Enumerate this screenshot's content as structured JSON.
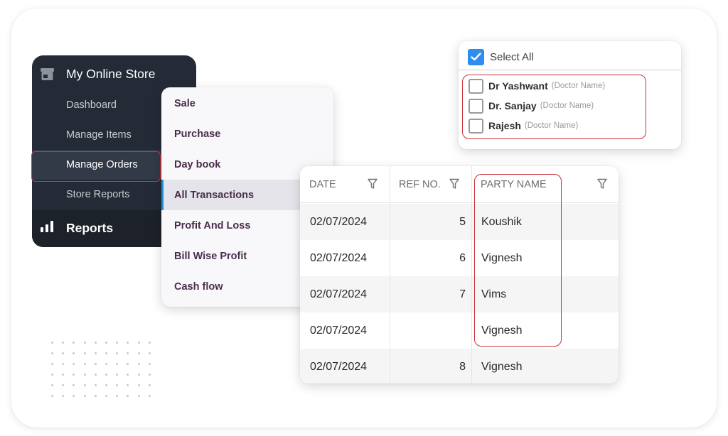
{
  "sidebar": {
    "store_title": "My Online Store",
    "store_icon": "storefront-icon",
    "items": [
      {
        "label": "Dashboard",
        "active": false
      },
      {
        "label": "Manage Items",
        "active": false
      },
      {
        "label": "Manage Orders",
        "active": true,
        "highlighted": true
      },
      {
        "label": "Store Reports",
        "active": false
      }
    ],
    "reports_label": "Reports",
    "reports_icon": "bar-chart-icon"
  },
  "submenu": {
    "items": [
      {
        "label": "Sale",
        "active": false
      },
      {
        "label": "Purchase",
        "active": false
      },
      {
        "label": "Day book",
        "active": false
      },
      {
        "label": "All Transactions",
        "active": true
      },
      {
        "label": "Profit And Loss",
        "active": false
      },
      {
        "label": "Bill Wise Profit",
        "active": false
      },
      {
        "label": "Cash flow",
        "active": false
      }
    ]
  },
  "filter_popup": {
    "select_all_label": "Select All",
    "select_all_checked": true,
    "options": [
      {
        "name": "Dr Yashwant",
        "hint": "(Doctor Name)",
        "checked": false
      },
      {
        "name": "Dr. Sanjay",
        "hint": "(Doctor Name)",
        "checked": false
      },
      {
        "name": "Rajesh",
        "hint": "(Doctor Name)",
        "checked": false
      }
    ]
  },
  "table": {
    "columns": [
      {
        "label": "DATE",
        "filter_icon": "filter-icon"
      },
      {
        "label": "REF NO.",
        "filter_icon": "filter-icon"
      },
      {
        "label": "PARTY NAME",
        "filter_icon": "filter-icon"
      }
    ],
    "rows": [
      {
        "date": "02/07/2024",
        "ref": "5",
        "party": "Koushik"
      },
      {
        "date": "02/07/2024",
        "ref": "6",
        "party": "Vignesh"
      },
      {
        "date": "02/07/2024",
        "ref": "7",
        "party": "Vims"
      },
      {
        "date": "02/07/2024",
        "ref": "",
        "party": "Vignesh"
      },
      {
        "date": "02/07/2024",
        "ref": "8",
        "party": "Vignesh"
      }
    ]
  },
  "colors": {
    "sidebar_bg": "#252b36",
    "highlight_red": "#c8323c",
    "submenu_text": "#4a2d4b",
    "active_accent": "#1f8fd1",
    "checkbox_blue": "#2e8df0"
  }
}
